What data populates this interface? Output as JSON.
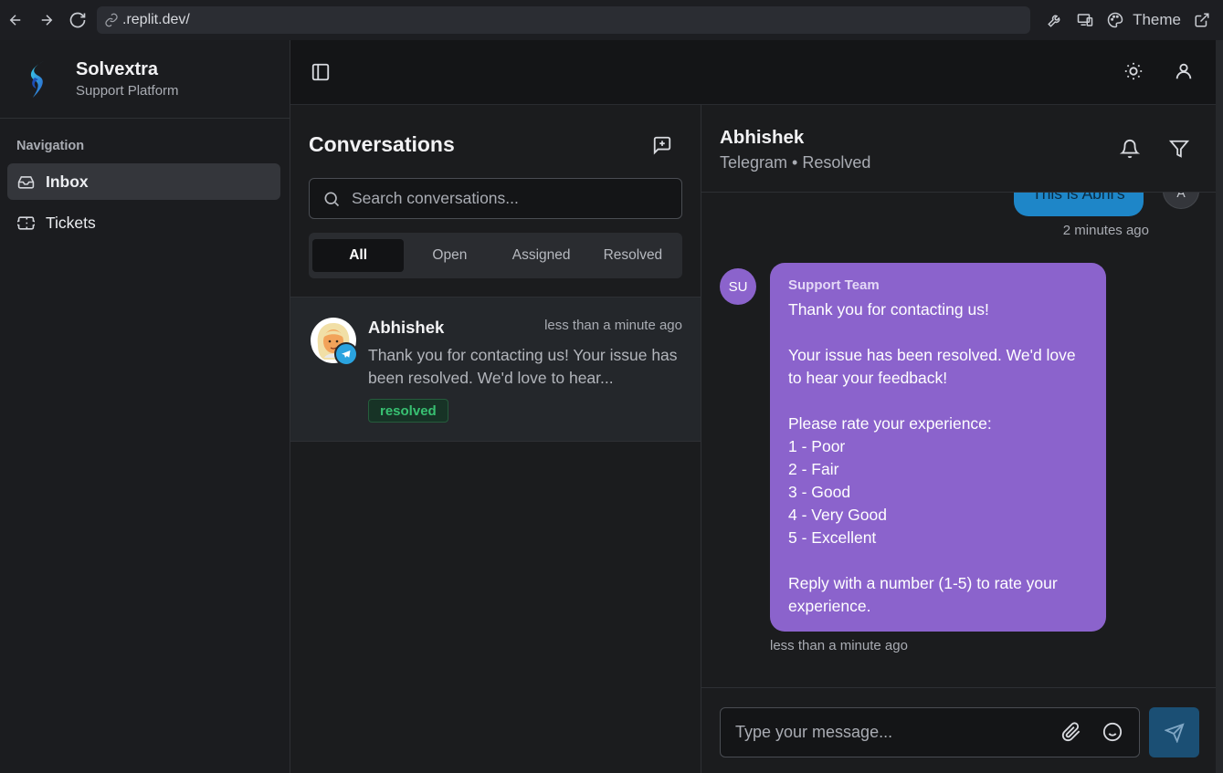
{
  "browser": {
    "url": ".replit.dev/",
    "theme_label": "Theme"
  },
  "sidebar": {
    "brand_name": "Solvextra",
    "brand_subtitle": "Support Platform",
    "nav_label": "Navigation",
    "items": [
      {
        "label": "Inbox",
        "icon": "inbox-icon",
        "active": true
      },
      {
        "label": "Tickets",
        "icon": "ticket-icon",
        "active": false
      }
    ]
  },
  "conversations": {
    "title": "Conversations",
    "search_placeholder": "Search conversations...",
    "filters": [
      "All",
      "Open",
      "Assigned",
      "Resolved"
    ],
    "active_filter": "All",
    "items": [
      {
        "name": "Abhishek",
        "time": "less than a minute ago",
        "preview": "Thank you for contacting us! Your issue has been resolved. We'd love to hear...",
        "status": "resolved",
        "channel": "telegram-icon"
      }
    ]
  },
  "chat": {
    "contact_name": "Abhishek",
    "subtitle": "Telegram • Resolved",
    "outgoing": {
      "text": "This is Abhi's",
      "avatar": "A",
      "time": "2 minutes ago"
    },
    "incoming": {
      "avatar": "SU",
      "sender": "Support Team",
      "text": "Thank you for contacting us!\n\nYour issue has been resolved. We'd love to hear your feedback!\n\nPlease rate your experience:\n1 - Poor\n2 - Fair\n3 - Good\n4 - Very Good\n5 - Excellent\n\nReply with a number (1-5) to rate your experience.",
      "time": "less than a minute ago"
    },
    "composer_placeholder": "Type your message..."
  },
  "colors": {
    "accent_purple": "#8b63cc",
    "accent_blue": "#1e86c8",
    "resolved_green": "#38c172"
  }
}
